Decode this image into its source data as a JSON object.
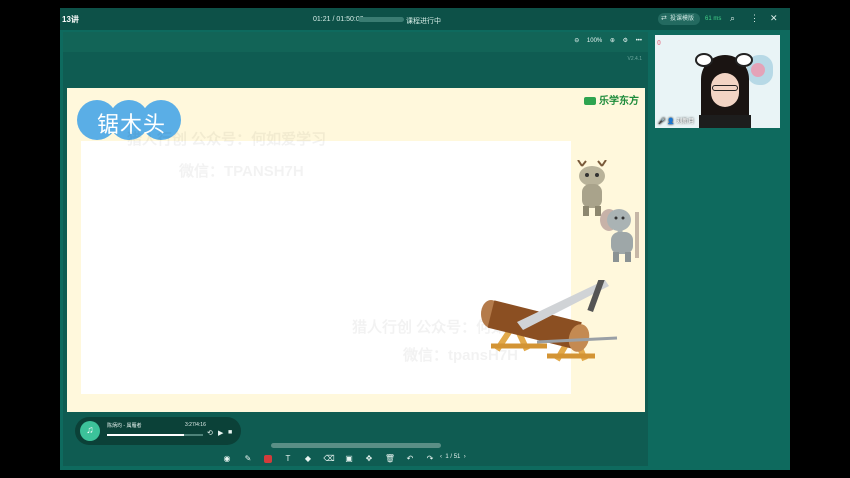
{
  "titlebar": {
    "lesson": "13讲",
    "time": "01:21 / 01:50:00",
    "status": "课程进行中",
    "mode_label": "投课模版",
    "network": "61 ms",
    "progress": 0.012
  },
  "board": {
    "zoom": "100%",
    "version": "V2.4.1"
  },
  "slide": {
    "brand": "乐学东方",
    "title": "锯木头",
    "watermark_line1": "猎人行创 公众号：何如爱学习",
    "watermark_line2": "微信：TPANSH7H",
    "watermark_line3": "猎人行创 公众号：何如爱学习",
    "watermark_line4": "微信：tpansH7H"
  },
  "player": {
    "song": "陈炳均 - 属雁者",
    "time": "3:27/4:16",
    "progress": 0.8
  },
  "pager": {
    "current": "1",
    "total": "/ 51"
  },
  "camera": {
    "name": "刘新月",
    "count": "0"
  },
  "icons": {
    "record": "record-icon",
    "pen": "pen-icon",
    "shape": "shape-icon",
    "text": "text-icon",
    "fill": "fill-icon",
    "eraser": "eraser-icon",
    "screen": "screen-icon",
    "move": "move-icon",
    "trash": "trash-icon",
    "undo": "undo-icon",
    "redo": "redo-icon"
  },
  "colors": {
    "app_bg": "#0e6a5e",
    "slide_bg": "#fff8dc",
    "title_bubble": "#5aaee6",
    "brand": "#1c8b3a"
  }
}
